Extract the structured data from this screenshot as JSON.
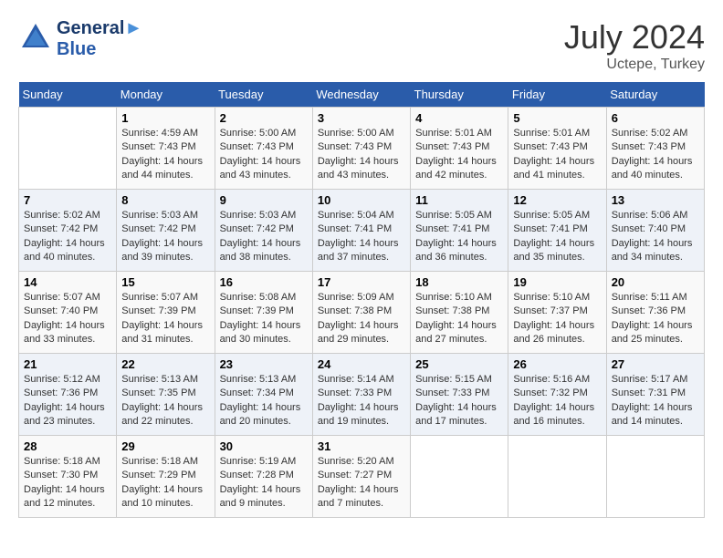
{
  "header": {
    "logo_line1": "General",
    "logo_line2": "Blue",
    "month_year": "July 2024",
    "location": "Uctepe, Turkey"
  },
  "weekdays": [
    "Sunday",
    "Monday",
    "Tuesday",
    "Wednesday",
    "Thursday",
    "Friday",
    "Saturday"
  ],
  "weeks": [
    [
      {
        "day": "",
        "sunrise": "",
        "sunset": "",
        "daylight": ""
      },
      {
        "day": "1",
        "sunrise": "Sunrise: 4:59 AM",
        "sunset": "Sunset: 7:43 PM",
        "daylight": "Daylight: 14 hours and 44 minutes."
      },
      {
        "day": "2",
        "sunrise": "Sunrise: 5:00 AM",
        "sunset": "Sunset: 7:43 PM",
        "daylight": "Daylight: 14 hours and 43 minutes."
      },
      {
        "day": "3",
        "sunrise": "Sunrise: 5:00 AM",
        "sunset": "Sunset: 7:43 PM",
        "daylight": "Daylight: 14 hours and 43 minutes."
      },
      {
        "day": "4",
        "sunrise": "Sunrise: 5:01 AM",
        "sunset": "Sunset: 7:43 PM",
        "daylight": "Daylight: 14 hours and 42 minutes."
      },
      {
        "day": "5",
        "sunrise": "Sunrise: 5:01 AM",
        "sunset": "Sunset: 7:43 PM",
        "daylight": "Daylight: 14 hours and 41 minutes."
      },
      {
        "day": "6",
        "sunrise": "Sunrise: 5:02 AM",
        "sunset": "Sunset: 7:43 PM",
        "daylight": "Daylight: 14 hours and 40 minutes."
      }
    ],
    [
      {
        "day": "7",
        "sunrise": "Sunrise: 5:02 AM",
        "sunset": "Sunset: 7:42 PM",
        "daylight": "Daylight: 14 hours and 40 minutes."
      },
      {
        "day": "8",
        "sunrise": "Sunrise: 5:03 AM",
        "sunset": "Sunset: 7:42 PM",
        "daylight": "Daylight: 14 hours and 39 minutes."
      },
      {
        "day": "9",
        "sunrise": "Sunrise: 5:03 AM",
        "sunset": "Sunset: 7:42 PM",
        "daylight": "Daylight: 14 hours and 38 minutes."
      },
      {
        "day": "10",
        "sunrise": "Sunrise: 5:04 AM",
        "sunset": "Sunset: 7:41 PM",
        "daylight": "Daylight: 14 hours and 37 minutes."
      },
      {
        "day": "11",
        "sunrise": "Sunrise: 5:05 AM",
        "sunset": "Sunset: 7:41 PM",
        "daylight": "Daylight: 14 hours and 36 minutes."
      },
      {
        "day": "12",
        "sunrise": "Sunrise: 5:05 AM",
        "sunset": "Sunset: 7:41 PM",
        "daylight": "Daylight: 14 hours and 35 minutes."
      },
      {
        "day": "13",
        "sunrise": "Sunrise: 5:06 AM",
        "sunset": "Sunset: 7:40 PM",
        "daylight": "Daylight: 14 hours and 34 minutes."
      }
    ],
    [
      {
        "day": "14",
        "sunrise": "Sunrise: 5:07 AM",
        "sunset": "Sunset: 7:40 PM",
        "daylight": "Daylight: 14 hours and 33 minutes."
      },
      {
        "day": "15",
        "sunrise": "Sunrise: 5:07 AM",
        "sunset": "Sunset: 7:39 PM",
        "daylight": "Daylight: 14 hours and 31 minutes."
      },
      {
        "day": "16",
        "sunrise": "Sunrise: 5:08 AM",
        "sunset": "Sunset: 7:39 PM",
        "daylight": "Daylight: 14 hours and 30 minutes."
      },
      {
        "day": "17",
        "sunrise": "Sunrise: 5:09 AM",
        "sunset": "Sunset: 7:38 PM",
        "daylight": "Daylight: 14 hours and 29 minutes."
      },
      {
        "day": "18",
        "sunrise": "Sunrise: 5:10 AM",
        "sunset": "Sunset: 7:38 PM",
        "daylight": "Daylight: 14 hours and 27 minutes."
      },
      {
        "day": "19",
        "sunrise": "Sunrise: 5:10 AM",
        "sunset": "Sunset: 7:37 PM",
        "daylight": "Daylight: 14 hours and 26 minutes."
      },
      {
        "day": "20",
        "sunrise": "Sunrise: 5:11 AM",
        "sunset": "Sunset: 7:36 PM",
        "daylight": "Daylight: 14 hours and 25 minutes."
      }
    ],
    [
      {
        "day": "21",
        "sunrise": "Sunrise: 5:12 AM",
        "sunset": "Sunset: 7:36 PM",
        "daylight": "Daylight: 14 hours and 23 minutes."
      },
      {
        "day": "22",
        "sunrise": "Sunrise: 5:13 AM",
        "sunset": "Sunset: 7:35 PM",
        "daylight": "Daylight: 14 hours and 22 minutes."
      },
      {
        "day": "23",
        "sunrise": "Sunrise: 5:13 AM",
        "sunset": "Sunset: 7:34 PM",
        "daylight": "Daylight: 14 hours and 20 minutes."
      },
      {
        "day": "24",
        "sunrise": "Sunrise: 5:14 AM",
        "sunset": "Sunset: 7:33 PM",
        "daylight": "Daylight: 14 hours and 19 minutes."
      },
      {
        "day": "25",
        "sunrise": "Sunrise: 5:15 AM",
        "sunset": "Sunset: 7:33 PM",
        "daylight": "Daylight: 14 hours and 17 minutes."
      },
      {
        "day": "26",
        "sunrise": "Sunrise: 5:16 AM",
        "sunset": "Sunset: 7:32 PM",
        "daylight": "Daylight: 14 hours and 16 minutes."
      },
      {
        "day": "27",
        "sunrise": "Sunrise: 5:17 AM",
        "sunset": "Sunset: 7:31 PM",
        "daylight": "Daylight: 14 hours and 14 minutes."
      }
    ],
    [
      {
        "day": "28",
        "sunrise": "Sunrise: 5:18 AM",
        "sunset": "Sunset: 7:30 PM",
        "daylight": "Daylight: 14 hours and 12 minutes."
      },
      {
        "day": "29",
        "sunrise": "Sunrise: 5:18 AM",
        "sunset": "Sunset: 7:29 PM",
        "daylight": "Daylight: 14 hours and 10 minutes."
      },
      {
        "day": "30",
        "sunrise": "Sunrise: 5:19 AM",
        "sunset": "Sunset: 7:28 PM",
        "daylight": "Daylight: 14 hours and 9 minutes."
      },
      {
        "day": "31",
        "sunrise": "Sunrise: 5:20 AM",
        "sunset": "Sunset: 7:27 PM",
        "daylight": "Daylight: 14 hours and 7 minutes."
      },
      {
        "day": "",
        "sunrise": "",
        "sunset": "",
        "daylight": ""
      },
      {
        "day": "",
        "sunrise": "",
        "sunset": "",
        "daylight": ""
      },
      {
        "day": "",
        "sunrise": "",
        "sunset": "",
        "daylight": ""
      }
    ]
  ]
}
